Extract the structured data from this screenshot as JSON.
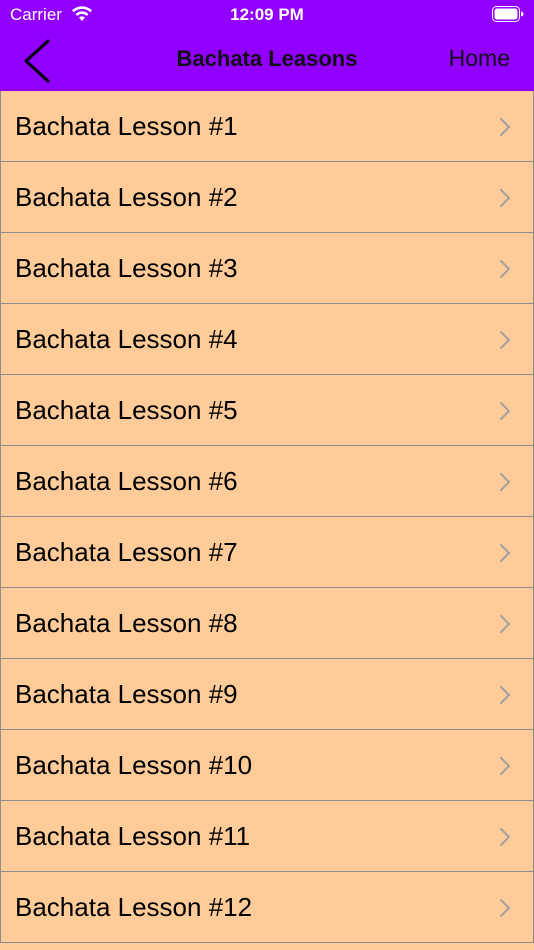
{
  "status_bar": {
    "carrier": "Carrier",
    "time": "12:09 PM",
    "icons": [
      "wifi-icon",
      "battery-icon"
    ]
  },
  "nav_bar": {
    "title": "Bachata Leasons",
    "back_icon": "chevron-left-icon",
    "home_label": "Home"
  },
  "colors": {
    "header_bg": "#9100ff",
    "row_bg": "#ffcc99",
    "separator": "#8c8c8c",
    "chevron": "#a0a0a0"
  },
  "lessons": [
    {
      "label": "Bachata Lesson #1"
    },
    {
      "label": "Bachata Lesson #2"
    },
    {
      "label": "Bachata Lesson #3"
    },
    {
      "label": "Bachata Lesson #4"
    },
    {
      "label": "Bachata Lesson #5"
    },
    {
      "label": "Bachata Lesson #6"
    },
    {
      "label": "Bachata Lesson #7"
    },
    {
      "label": "Bachata Lesson #8"
    },
    {
      "label": "Bachata Lesson #9"
    },
    {
      "label": "Bachata Lesson #10"
    },
    {
      "label": "Bachata Lesson #11"
    },
    {
      "label": "Bachata Lesson #12"
    }
  ]
}
